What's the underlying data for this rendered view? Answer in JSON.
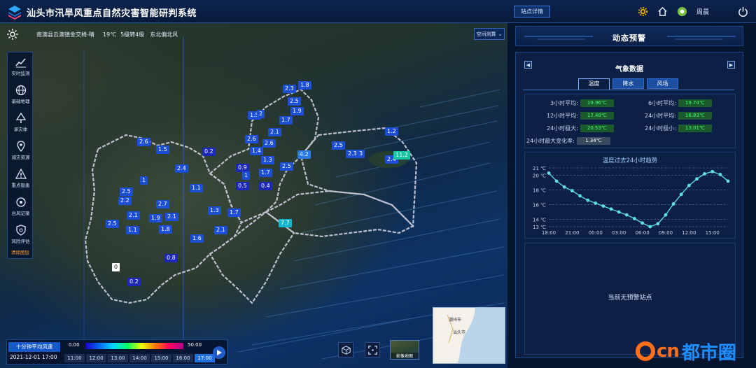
{
  "header": {
    "title": "汕头市汛旱风重点自然灾害智能研判系统",
    "station_btn": "站点详情",
    "user": "周晨"
  },
  "topbar": {
    "location": "南澳县云澳镇金交椅-晴",
    "temp": "19℃",
    "wind_level": "5级转4级",
    "wind_dir": "东北偏北风",
    "space_btn": "空间测算"
  },
  "sidebar": {
    "items": [
      {
        "label": "实时监测",
        "icon": "chart-line-icon"
      },
      {
        "label": "基础地理",
        "icon": "globe-icon"
      },
      {
        "label": "承灾体",
        "icon": "tree-icon"
      },
      {
        "label": "减灾资源",
        "icon": "map-pin-icon"
      },
      {
        "label": "重点隐患",
        "icon": "warning-icon"
      },
      {
        "label": "台风记录",
        "icon": "typhoon-icon"
      },
      {
        "label": "风险评估",
        "icon": "shield-icon"
      }
    ],
    "clear": "清除图层"
  },
  "map": {
    "stations": [
      {
        "v": "1.8",
        "c": "#1c4fd6"
      },
      {
        "v": "2.3",
        "c": "#1c4fd6"
      },
      {
        "v": "2.5",
        "c": "#1c4fd6"
      },
      {
        "v": "1.9",
        "c": "#1c4fd6"
      },
      {
        "v": "1.5",
        "c": "#1c4fd6"
      },
      {
        "v": "2",
        "c": "#1c4fd6"
      },
      {
        "v": "1.7",
        "c": "#1c4fd6"
      },
      {
        "v": "2.1",
        "c": "#1c4fd6"
      },
      {
        "v": "2.6",
        "c": "#1c4fd6"
      },
      {
        "v": "2.6",
        "c": "#1c4fd6"
      },
      {
        "v": "1.5",
        "c": "#1c4fd6"
      },
      {
        "v": "1.4",
        "c": "#1c4fd6"
      },
      {
        "v": "0.2",
        "c": "#1c28b8"
      },
      {
        "v": "1.3",
        "c": "#1c4fd6"
      },
      {
        "v": "4.2",
        "c": "#2a7be8"
      },
      {
        "v": "2.4",
        "c": "#1c4fd6"
      },
      {
        "v": "0.9",
        "c": "#1c28b8"
      },
      {
        "v": "1.7",
        "c": "#1c4fd6"
      },
      {
        "v": "2.5",
        "c": "#1c4fd6"
      },
      {
        "v": "1",
        "c": "#1c4fd6"
      },
      {
        "v": "0.5",
        "c": "#1c28b8"
      },
      {
        "v": "0.4",
        "c": "#1c28b8"
      },
      {
        "v": "1",
        "c": "#1c4fd6"
      },
      {
        "v": "1.1",
        "c": "#1c4fd6"
      },
      {
        "v": "2.5",
        "c": "#1c4fd6"
      },
      {
        "v": "2.2",
        "c": "#1c4fd6"
      },
      {
        "v": "2.7",
        "c": "#1c4fd6"
      },
      {
        "v": "2.1",
        "c": "#1c4fd6"
      },
      {
        "v": "1.9",
        "c": "#1c4fd6"
      },
      {
        "v": "2.1",
        "c": "#1c4fd6"
      },
      {
        "v": "2.5",
        "c": "#1c4fd6"
      },
      {
        "v": "1.1",
        "c": "#1c4fd6"
      },
      {
        "v": "1.8",
        "c": "#1c4fd6"
      },
      {
        "v": "1.3",
        "c": "#1c4fd6"
      },
      {
        "v": "1.7",
        "c": "#1c4fd6"
      },
      {
        "v": "2.1",
        "c": "#1c4fd6"
      },
      {
        "v": "1.6",
        "c": "#1c4fd6"
      },
      {
        "v": "0",
        "c": "#ffffff"
      },
      {
        "v": "0.8",
        "c": "#1c28b8"
      },
      {
        "v": "0.2",
        "c": "#1c28b8"
      },
      {
        "v": "2.5",
        "c": "#1c4fd6"
      },
      {
        "v": "2.3",
        "c": "#1c4fd6"
      },
      {
        "v": "3",
        "c": "#1c4fd6"
      },
      {
        "v": "1.2",
        "c": "#1c4fd6"
      },
      {
        "v": "2.4",
        "c": "#1c4fd6"
      },
      {
        "v": "11.2",
        "c": "#17c6a0"
      },
      {
        "v": "7.7",
        "c": "#17b6d0"
      },
      {
        "v": "2.6",
        "c": "#1c4fd6"
      }
    ]
  },
  "legend": {
    "title": "十分钟平均风速",
    "date": "2021-12-01 17:00",
    "min": "0.00",
    "max": "50.00",
    "times": [
      "11:00",
      "12:00",
      "13:00",
      "14:00",
      "15:00",
      "16:00",
      "17:00"
    ],
    "active_time": "17:00"
  },
  "toolbar": {
    "image_map": "影像地图"
  },
  "minimap": {
    "label_a": "潮州市",
    "label_b": "汕头市"
  },
  "right": {
    "head": "动态预警",
    "section": "气象数据",
    "tabs": [
      "温度",
      "降水",
      "风场"
    ],
    "active_tab": "温度",
    "stats": [
      {
        "label": "3小时平均:",
        "value": "19.96℃"
      },
      {
        "label": "6小时平均:",
        "value": "19.74℃"
      },
      {
        "label": "12小时平均:",
        "value": "17.48℃"
      },
      {
        "label": "24小时平均:",
        "value": "16.83℃"
      },
      {
        "label": "24小时极大:",
        "value": "20.53℃"
      },
      {
        "label": "24小时极小:",
        "value": "13.01℃"
      },
      {
        "label": "24小时最大变化率:",
        "value": "1.34℃"
      }
    ],
    "no_warning": "当前无预警站点"
  },
  "chart_data": {
    "type": "line",
    "title": "温度过去24小时趋势",
    "x": [
      "18:00",
      "19:00",
      "20:00",
      "21:00",
      "22:00",
      "23:00",
      "00:00",
      "01:00",
      "02:00",
      "03:00",
      "04:00",
      "05:00",
      "06:00",
      "07:00",
      "08:00",
      "09:00",
      "10:00",
      "11:00",
      "12:00",
      "13:00",
      "14:00",
      "15:00",
      "16:00",
      "17:00"
    ],
    "xticks": [
      "18:00",
      "21:00",
      "00:00",
      "03:00",
      "06:00",
      "09:00",
      "12:00",
      "15:00"
    ],
    "y": [
      20.3,
      19.2,
      18.4,
      17.9,
      17.2,
      16.6,
      16.2,
      15.8,
      15.4,
      15.0,
      14.6,
      14.1,
      13.5,
      13.0,
      13.4,
      14.6,
      16.1,
      17.4,
      18.6,
      19.5,
      20.2,
      20.5,
      20.1,
      19.2
    ],
    "yticks": [
      13,
      14,
      16,
      18,
      20,
      21
    ],
    "ytick_labels": [
      "13 ℃",
      "14 ℃",
      "16 ℃",
      "18 ℃",
      "20 ℃",
      "21 ℃"
    ],
    "ylim": [
      13,
      21
    ],
    "color": "#5fe0e8"
  },
  "watermark": {
    "brand": "cn",
    "name": "都市圈"
  }
}
